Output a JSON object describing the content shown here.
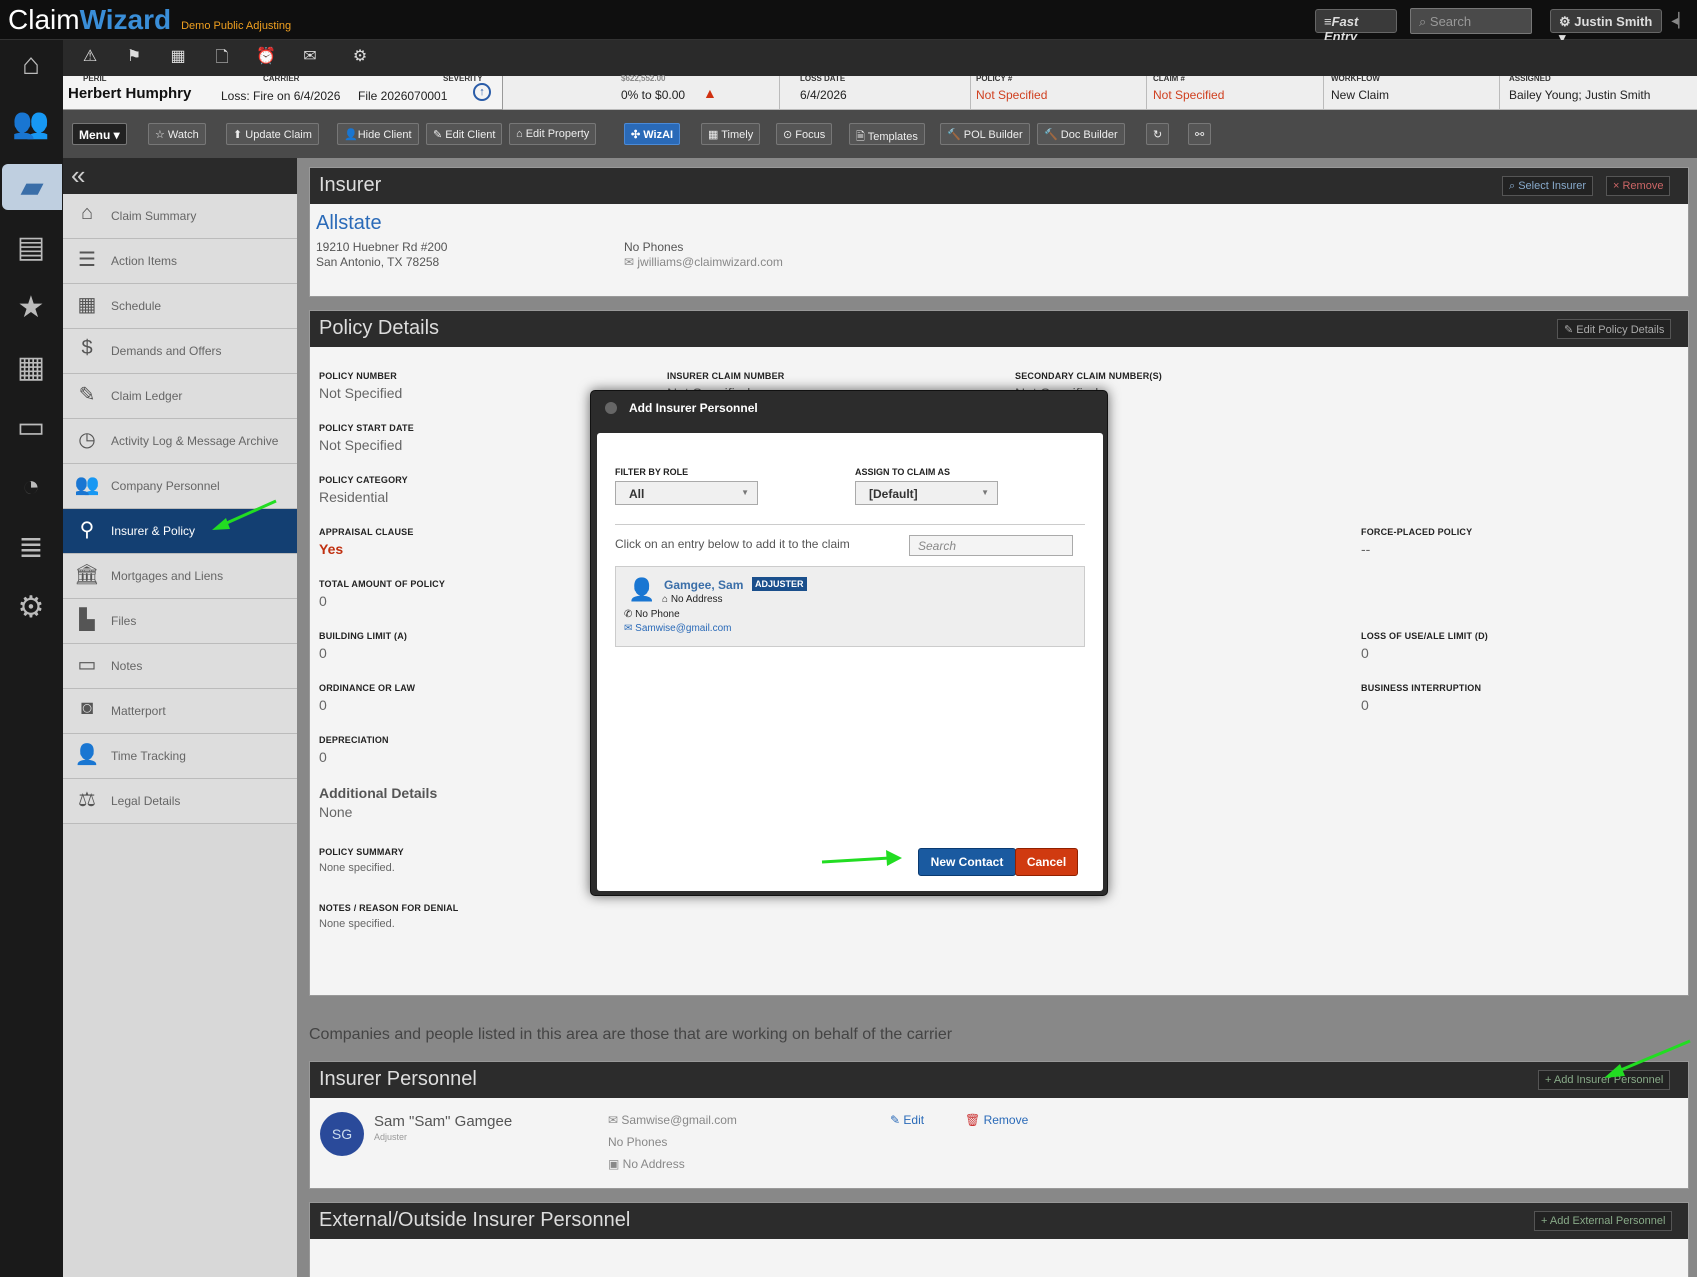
{
  "topbar": {
    "logo_claim": "Claim",
    "logo_wizard": "Wizard",
    "tagline": "Demo Public Adjusting",
    "fast_entry": "≡Fast Entry",
    "search_placeholder": "Search",
    "user": "⚙ Justin Smith ▾"
  },
  "claim_header": {
    "client_name": "Herbert Humphry",
    "peril_label": "PERIL",
    "carrier_label": "CARRIER",
    "severity_label": "SEVERITY",
    "loss": "Loss: Fire on 6/4/2026",
    "file": "File 2026070001",
    "progress_label": "$622,552.00",
    "progress_value": "0% to $0.00",
    "loss_date_label": "LOSS DATE",
    "loss_date": "6/4/2026",
    "policy_label": "POLICY #",
    "policy_value": "Not Specified",
    "claim_label": "CLAIM #",
    "claim_value": "Not Specified",
    "workflow_label": "WORKFLOW",
    "workflow_value": "New Claim",
    "assigned_label": "ASSIGNED",
    "assigned_value": "Bailey Young; Justin Smith"
  },
  "actionbar": {
    "menu": "Menu ▾",
    "watch": "☆ Watch",
    "update_claim": "⬆ Update Claim",
    "hide_client": "👤Hide Client",
    "edit_client": "✎ Edit Client",
    "edit_property": "⌂ Edit Property",
    "wizai": "✣ WizAI",
    "timely": "▦ Timely",
    "focus": "⊙ Focus",
    "templates": "🗎 Templates",
    "pol_builder": "🔨 POL Builder",
    "doc_builder": "🔨 Doc Builder",
    "refresh": "↻",
    "links": "⚯"
  },
  "sidenav": {
    "collapse": "«",
    "items": [
      {
        "label": "Claim Summary"
      },
      {
        "label": "Action Items"
      },
      {
        "label": "Schedule"
      },
      {
        "label": "Demands and Offers"
      },
      {
        "label": "Claim Ledger"
      },
      {
        "label": "Activity Log & Message Archive"
      },
      {
        "label": "Company Personnel"
      },
      {
        "label": "Insurer & Policy"
      },
      {
        "label": "Mortgages and Liens"
      },
      {
        "label": "Files"
      },
      {
        "label": "Notes"
      },
      {
        "label": "Matterport"
      },
      {
        "label": "Time Tracking"
      },
      {
        "label": "Legal Details"
      }
    ]
  },
  "insurer": {
    "title": "Insurer",
    "select_btn": "Select Insurer",
    "remove_btn": "× Remove",
    "name": "Allstate",
    "address1": "19210 Huebner Rd #200",
    "address2": "San Antonio, TX 78258",
    "phones": "No Phones",
    "email": "jwilliams@claimwizard.com"
  },
  "policy": {
    "title": "Policy Details",
    "edit_btn": "Edit Policy Details",
    "policy_number_label": "POLICY NUMBER",
    "policy_number": "Not Specified",
    "insurer_claim_label": "INSURER CLAIM NUMBER",
    "insurer_claim": "Not Specified",
    "secondary_label": "SECONDARY CLAIM NUMBER(S)",
    "secondary": "Not Specified",
    "start_label": "POLICY START DATE",
    "start": "Not Specified",
    "category_label": "POLICY CATEGORY",
    "category": "Residential",
    "appraisal_label": "APPRAISAL CLAUSE",
    "appraisal": "Yes",
    "forced_label": "FORCE-PLACED POLICY",
    "forced": "--",
    "total_label": "TOTAL AMOUNT OF POLICY",
    "total": "0",
    "building_label": "BUILDING LIMIT (A)",
    "building": "0",
    "loss_use_label": "LOSS OF USE/ALE LIMIT (D)",
    "loss_use": "0",
    "ordinance_label": "ORDINANCE OR LAW",
    "ordinance": "0",
    "business_label": "BUSINESS INTERRUPTION",
    "business": "0",
    "depreciation_label": "DEPRECIATION",
    "depreciation": "0",
    "additional_label": "Additional Details",
    "additional": "None",
    "summary_label": "POLICY SUMMARY",
    "summary": "None specified.",
    "notes_label": "NOTES / REASON FOR DENIAL",
    "notes": "None specified."
  },
  "info_text": "Companies and people listed in this area are those that are working on behalf of the carrier",
  "personnel": {
    "title": "Insurer Personnel",
    "add_btn": "+ Add Insurer Personnel",
    "initials": "SG",
    "name": "Sam \"Sam\" Gamgee",
    "role": "Adjuster",
    "email": "Samwise@gmail.com",
    "phones": "No Phones",
    "address": "No Address",
    "edit": "Edit",
    "remove": "Remove"
  },
  "external": {
    "title": "External/Outside Insurer Personnel",
    "add_btn": "+ Add External Personnel"
  },
  "modal": {
    "title": "Add Insurer Personnel",
    "filter_label": "FILTER BY ROLE",
    "filter_value": "All",
    "assign_label": "ASSIGN TO CLAIM AS",
    "assign_value": "[Default]",
    "click_text": "Click on an entry below to add it to the claim",
    "search_placeholder": "Search",
    "entry_name": "Gamgee, Sam",
    "entry_badge": "ADJUSTER",
    "entry_address": "No Address",
    "entry_phone": "No Phone",
    "entry_email": "Samwise@gmail.com",
    "new_contact": "New Contact",
    "cancel": "Cancel"
  },
  "colors": {
    "accent": "#2a6ab8",
    "active_nav": "#133f72",
    "danger": "#d03a10",
    "arrow": "#22dd22"
  }
}
